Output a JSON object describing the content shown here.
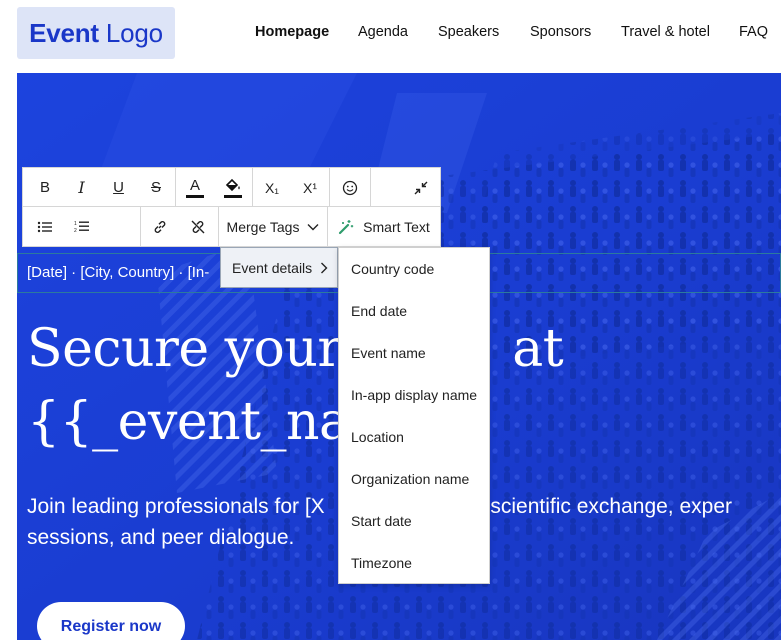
{
  "header": {
    "logo_bold": "Event",
    "logo_rest": "Logo",
    "nav": [
      "Homepage",
      "Agenda",
      "Speakers",
      "Sponsors",
      "Travel & hotel",
      "FAQ"
    ],
    "active_nav": "Homepage"
  },
  "hero": {
    "date_line": "[Date] · [City, Country] · [In-",
    "title": "Secure your    at\n{{_event_na",
    "subtitle": "Join leading professionals for [X      sed scientific exchange, exper\nsessions, and peer dialogue.",
    "register_label": "Register now"
  },
  "toolbar": {
    "row1": [
      "bold",
      "italic",
      "underline",
      "strikethrough",
      "text-color",
      "highlight-color",
      "subscript",
      "superscript",
      "emoji",
      "collapse"
    ],
    "row2": [
      "bullet-list",
      "numbered-list",
      "link",
      "unlink"
    ],
    "bold": "B",
    "italic": "I",
    "underline": "U",
    "strike": "S",
    "text_color": "A",
    "subscript": "X₁",
    "superscript": "X¹",
    "merge_tags_label": "Merge Tags",
    "smart_text_label": "Smart Text"
  },
  "merge_menu": {
    "category": "Event details",
    "items": [
      "Country code",
      "End date",
      "Event name",
      "In-app display name",
      "Location",
      "Organization name",
      "Start date",
      "Timezone"
    ]
  },
  "colors": {
    "brand_blue": "#1a37c8",
    "hero_blue": "#1a3fd6",
    "logo_bg": "#dde4f7"
  }
}
